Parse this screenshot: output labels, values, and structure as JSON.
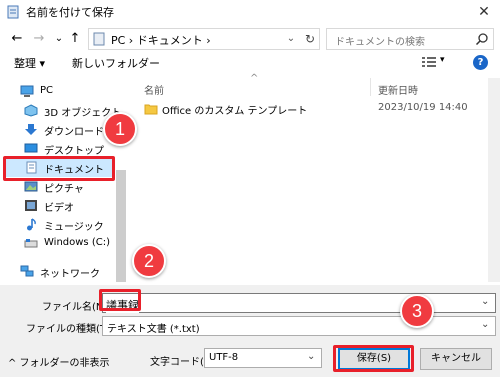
{
  "window": {
    "title": "名前を付けて保存",
    "close": "✕"
  },
  "nav": {
    "back": "←",
    "forward": "→",
    "dropdown": "⌄",
    "up": "↑",
    "address": "PC › ドキュメント ›",
    "address_dd": "⌄",
    "refresh": "↻",
    "search_placeholder": "ドキュメントの検索"
  },
  "toolbar": {
    "organize": "整理 ▾",
    "new_folder": "新しいフォルダー",
    "view_dd": "▾",
    "help": "?"
  },
  "sidebar": {
    "items": [
      {
        "label": "PC",
        "icon": "pc-icon"
      },
      {
        "label": "3D オブジェクト",
        "icon": "3d-objects-icon"
      },
      {
        "label": "ダウンロード",
        "icon": "download-icon"
      },
      {
        "label": "デスクトップ",
        "icon": "desktop-icon"
      },
      {
        "label": "ドキュメント",
        "icon": "documents-icon"
      },
      {
        "label": "ピクチャ",
        "icon": "pictures-icon"
      },
      {
        "label": "ビデオ",
        "icon": "video-icon"
      },
      {
        "label": "ミュージック",
        "icon": "music-icon"
      },
      {
        "label": "Windows (C:)",
        "icon": "drive-icon"
      },
      {
        "label": "ネットワーク",
        "icon": "network-icon"
      }
    ]
  },
  "filelist": {
    "col_name": "名前",
    "sort_indicator": "^",
    "col_date": "更新日時",
    "rows": [
      {
        "name": "Office のカスタム テンプレート",
        "date": "2023/10/19 14:40",
        "icon": "folder-icon"
      }
    ]
  },
  "form": {
    "filename_label": "ファイル名(N):",
    "filename_value": "議事録",
    "filetype_label": "ファイルの種類(T):",
    "filetype_value": "テキスト文書 (*.txt)",
    "hide_folders": "^  フォルダーの非表示",
    "encoding_label": "文字コード(E):",
    "encoding_value": "UTF-8",
    "save": "保存(S)",
    "cancel": "キャンセル",
    "dd": "⌄"
  },
  "annotations": {
    "step1": "1",
    "step2": "2",
    "step3": "3"
  },
  "colors": {
    "accent": "#0078d7",
    "annotation_red": "#e8202a",
    "marker_red": "#f03b40",
    "selection": "#cce8ff"
  }
}
